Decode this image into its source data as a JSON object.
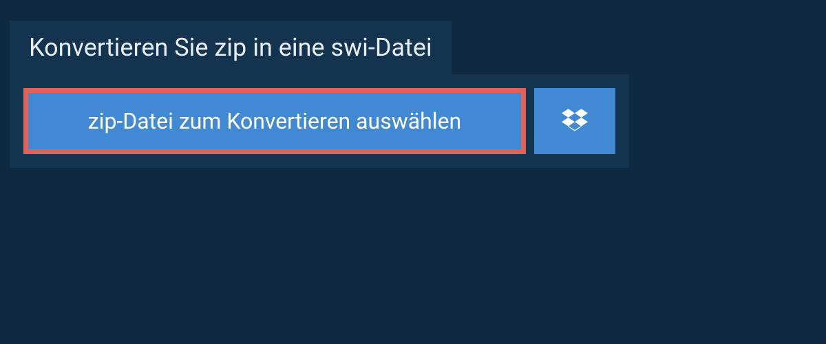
{
  "header": {
    "title": "Konvertieren Sie zip in eine swi-Datei"
  },
  "upload": {
    "select_label": "zip-Datei zum Konvertieren auswählen"
  }
}
